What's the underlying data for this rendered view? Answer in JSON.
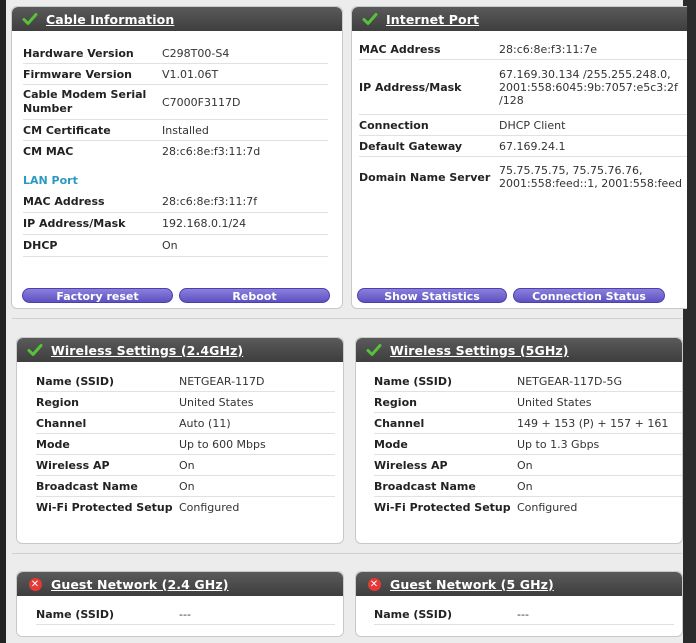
{
  "colors": {
    "header": "#4a4a4a",
    "check": "#58c13a",
    "error": "#e53935",
    "section": "#2d99c3",
    "button": "#6b5ecf"
  },
  "cable": {
    "title": "Cable Information",
    "icon": "check-icon",
    "rows": [
      {
        "label": "Hardware Version",
        "value": "C298T00-S4"
      },
      {
        "label": "Firmware Version",
        "value": "V1.01.06T"
      },
      {
        "label": "Cable Modem Serial Number",
        "value": "C7000F3117D"
      },
      {
        "label": "CM Certificate",
        "value": "Installed"
      },
      {
        "label": "CM MAC",
        "value": "28:c6:8e:f3:11:7d"
      }
    ],
    "lan_title": "LAN Port",
    "lan_rows": [
      {
        "label": "MAC Address",
        "value": "28:c6:8e:f3:11:7f"
      },
      {
        "label": "IP Address/Mask",
        "value": "192.168.0.1/24"
      },
      {
        "label": "DHCP",
        "value": "On"
      }
    ],
    "buttons": {
      "factory_reset": "Factory reset",
      "reboot": "Reboot"
    }
  },
  "internet": {
    "title": "Internet Port",
    "icon": "check-icon",
    "rows": [
      {
        "label": "MAC Address",
        "value": "28:c6:8e:f3:11:7e"
      },
      {
        "label": "IP Address/Mask",
        "value": "67.169.30.134 /255.255.248.0, 2001:558:6045:9b:7057:e5c3:2f /128"
      },
      {
        "label": "Connection",
        "value": "DHCP Client"
      },
      {
        "label": "Default Gateway",
        "value": "67.169.24.1"
      },
      {
        "label": "Domain Name Server",
        "value": "75.75.75.75, 75.75.76.76, 2001:558:feed::1, 2001:558:feed"
      }
    ],
    "buttons": {
      "show_statistics": "Show Statistics",
      "connection_status": "Connection Status"
    }
  },
  "wireless24": {
    "title": "Wireless Settings (2.4GHz)",
    "icon": "check-icon",
    "rows": [
      {
        "label": "Name (SSID)",
        "value": "NETGEAR-117D"
      },
      {
        "label": "Region",
        "value": "United States"
      },
      {
        "label": "Channel",
        "value": "Auto (11)"
      },
      {
        "label": "Mode",
        "value": "Up to 600 Mbps"
      },
      {
        "label": "Wireless AP",
        "value": "On"
      },
      {
        "label": "Broadcast Name",
        "value": "On"
      },
      {
        "label": "Wi-Fi Protected Setup",
        "value": "Configured"
      }
    ]
  },
  "wireless5": {
    "title": "Wireless Settings (5GHz)",
    "icon": "check-icon",
    "rows": [
      {
        "label": "Name (SSID)",
        "value": "NETGEAR-117D-5G"
      },
      {
        "label": "Region",
        "value": "United States"
      },
      {
        "label": "Channel",
        "value": "149 + 153 (P) + 157 + 161"
      },
      {
        "label": "Mode",
        "value": "Up to 1.3 Gbps"
      },
      {
        "label": "Wireless AP",
        "value": "On"
      },
      {
        "label": "Broadcast Name",
        "value": "On"
      },
      {
        "label": "Wi-Fi Protected Setup",
        "value": "Configured"
      }
    ]
  },
  "guest24": {
    "title": "Guest Network (2.4 GHz)",
    "icon": "error-icon",
    "rows": [
      {
        "label": "Name (SSID)",
        "value": "---"
      }
    ]
  },
  "guest5": {
    "title": "Guest Network (5 GHz)",
    "icon": "error-icon",
    "rows": [
      {
        "label": "Name (SSID)",
        "value": "---"
      }
    ]
  }
}
